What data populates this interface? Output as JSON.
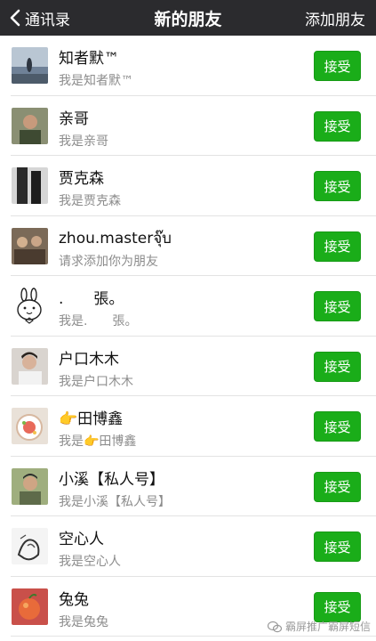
{
  "navbar": {
    "back_label": "通讯录",
    "title": "新的朋友",
    "action_label": "添加朋友"
  },
  "accept_label": "接受",
  "requests": [
    {
      "name": "知者默™",
      "message": "我是知者默™",
      "avatar_icon": "avatar-photo-lake"
    },
    {
      "name": "亲哥",
      "message": "我是亲哥",
      "avatar_icon": "avatar-photo-person"
    },
    {
      "name": "贾克森",
      "message": "我是贾克森",
      "avatar_icon": "avatar-photo-dark"
    },
    {
      "name": "zhou.masterจุ๊บ",
      "message": "请求添加你为朋友",
      "avatar_icon": "avatar-photo-group"
    },
    {
      "name": ".　　張。",
      "message": "我是.　　張。",
      "avatar_icon": "avatar-cartoon-rabbit"
    },
    {
      "name": "户口木木",
      "message": "我是户口木木",
      "avatar_icon": "avatar-photo-person"
    },
    {
      "name": "👉田博鑫",
      "message": "我是👉田博鑫",
      "avatar_icon": "avatar-photo-cake"
    },
    {
      "name": "小溪【私人号】",
      "message": "我是小溪【私人号】",
      "avatar_icon": "avatar-photo-person"
    },
    {
      "name": "空心人",
      "message": "我是空心人",
      "avatar_icon": "avatar-ink-sketch"
    },
    {
      "name": "兔兔",
      "message": "我是兔兔",
      "avatar_icon": "avatar-photo-fruit"
    }
  ],
  "watermark": {
    "text": "霸屏推广霸屏短信",
    "icon": "wechat-official-icon"
  },
  "colors": {
    "navbar_bg": "#2b2b2e",
    "accept_green": "#1aad19",
    "subtext": "#8c8c8c"
  }
}
